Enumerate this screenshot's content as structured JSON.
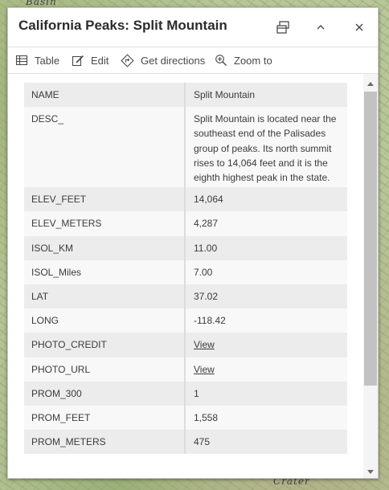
{
  "map": {
    "label_top": "Basin",
    "label_bottom": "Crater"
  },
  "popup": {
    "title": "California Peaks: Split Mountain",
    "buttons": {
      "dock": "dock-icon",
      "collapse": "chevron-up-icon",
      "close": "close-icon"
    },
    "actions": [
      {
        "label": "Table",
        "icon": "table-icon"
      },
      {
        "label": "Edit",
        "icon": "edit-icon"
      },
      {
        "label": "Get directions",
        "icon": "directions-icon"
      },
      {
        "label": "Zoom to",
        "icon": "zoom-to-icon"
      }
    ],
    "attributes": [
      {
        "field": "NAME",
        "value": "Split Mountain"
      },
      {
        "field": "DESC_",
        "value": "Split Mountain is located near the southeast end of the Palisades group of peaks. Its north summit rises to 14,064 feet and it is the eighth highest peak in the state."
      },
      {
        "field": "ELEV_FEET",
        "value": "14,064"
      },
      {
        "field": "ELEV_METERS",
        "value": "4,287"
      },
      {
        "field": "ISOL_KM",
        "value": "11.00"
      },
      {
        "field": "ISOL_Miles",
        "value": "7.00"
      },
      {
        "field": "LAT",
        "value": "37.02"
      },
      {
        "field": "LONG",
        "value": "-118.42"
      },
      {
        "field": "PHOTO_CREDIT",
        "value": "View"
      },
      {
        "field": "PHOTO_URL",
        "value": "View"
      },
      {
        "field": "PROM_300",
        "value": "1"
      },
      {
        "field": "PROM_FEET",
        "value": "1,558"
      },
      {
        "field": "PROM_METERS",
        "value": "475"
      }
    ]
  }
}
